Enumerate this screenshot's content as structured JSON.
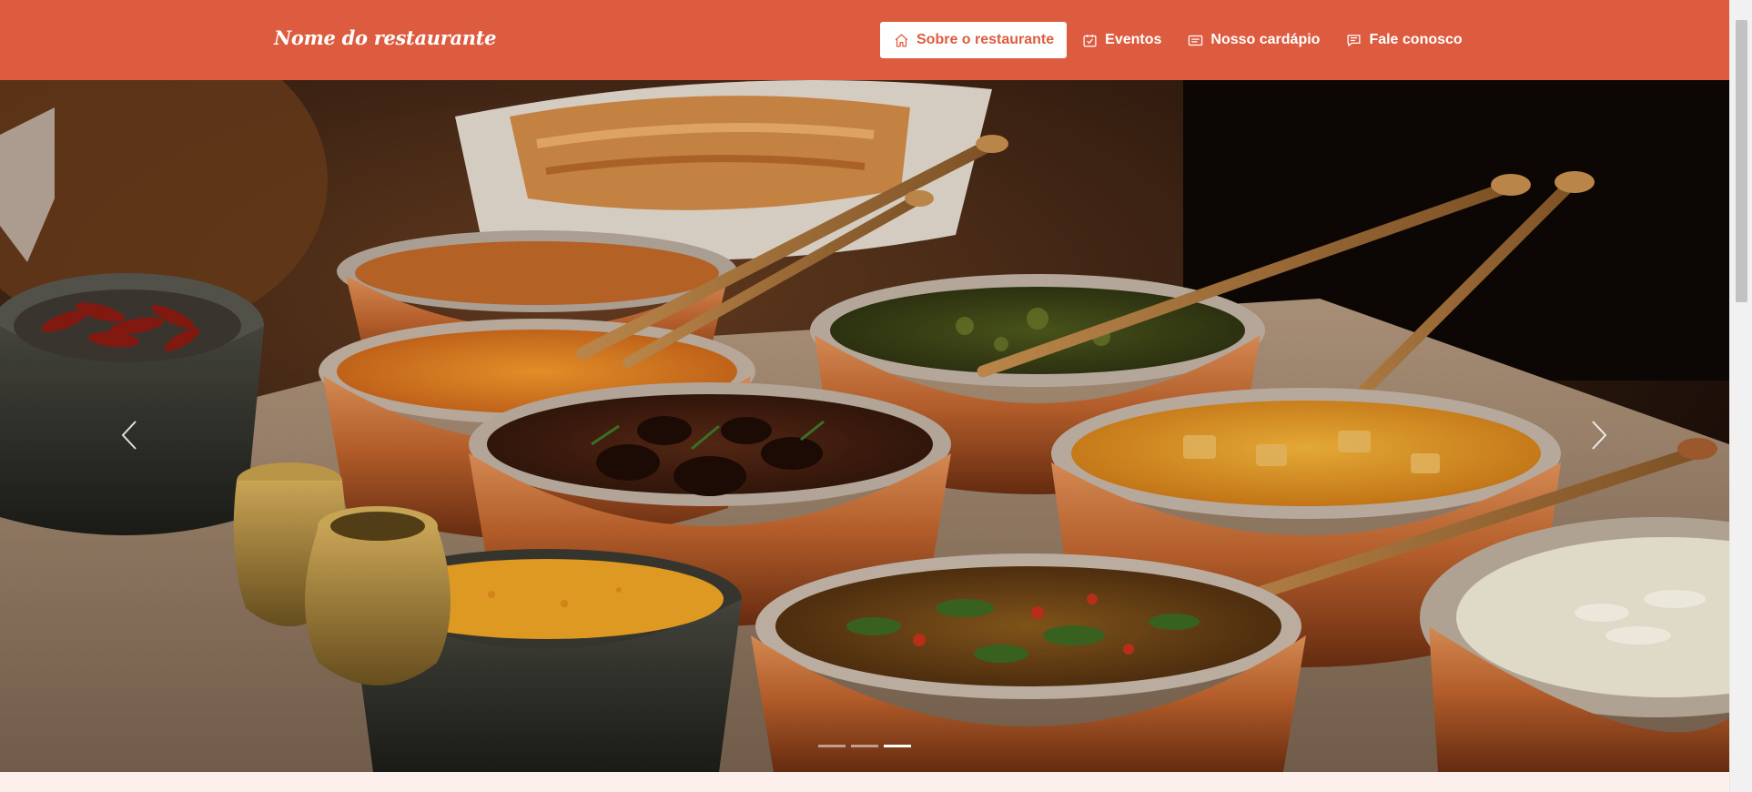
{
  "brand": {
    "name": "Nome do restaurante"
  },
  "nav": {
    "items": [
      {
        "label": "Sobre o restaurante",
        "icon": "home-icon",
        "active": true
      },
      {
        "label": "Eventos",
        "icon": "calendar-check-icon",
        "active": false
      },
      {
        "label": "Nosso cardápio",
        "icon": "menu-card-icon",
        "active": false
      },
      {
        "label": "Fale conosco",
        "icon": "chat-icon",
        "active": false
      }
    ]
  },
  "carousel": {
    "slide_count": 3,
    "active_slide": 3,
    "prev_icon": "chevron-left-icon",
    "next_icon": "chevron-right-icon"
  },
  "colors": {
    "navbar": "#dd5c40",
    "active_nav_bg": "#ffffff",
    "active_nav_text": "#dd5c40",
    "page_background": "#fdf0ec"
  }
}
